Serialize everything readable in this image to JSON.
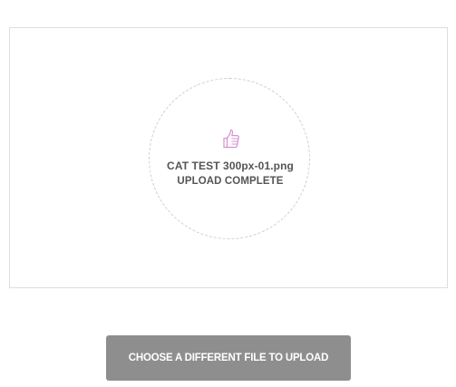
{
  "upload": {
    "icon": "thumbs-up-icon",
    "icon_color": "#d88fd2",
    "file_name": "CAT TEST 300px-01.png",
    "status": "UPLOAD COMPLETE"
  },
  "actions": {
    "choose_different_label": "CHOOSE A DIFFERENT FILE TO UPLOAD",
    "button_color": "#8e8e8e"
  }
}
